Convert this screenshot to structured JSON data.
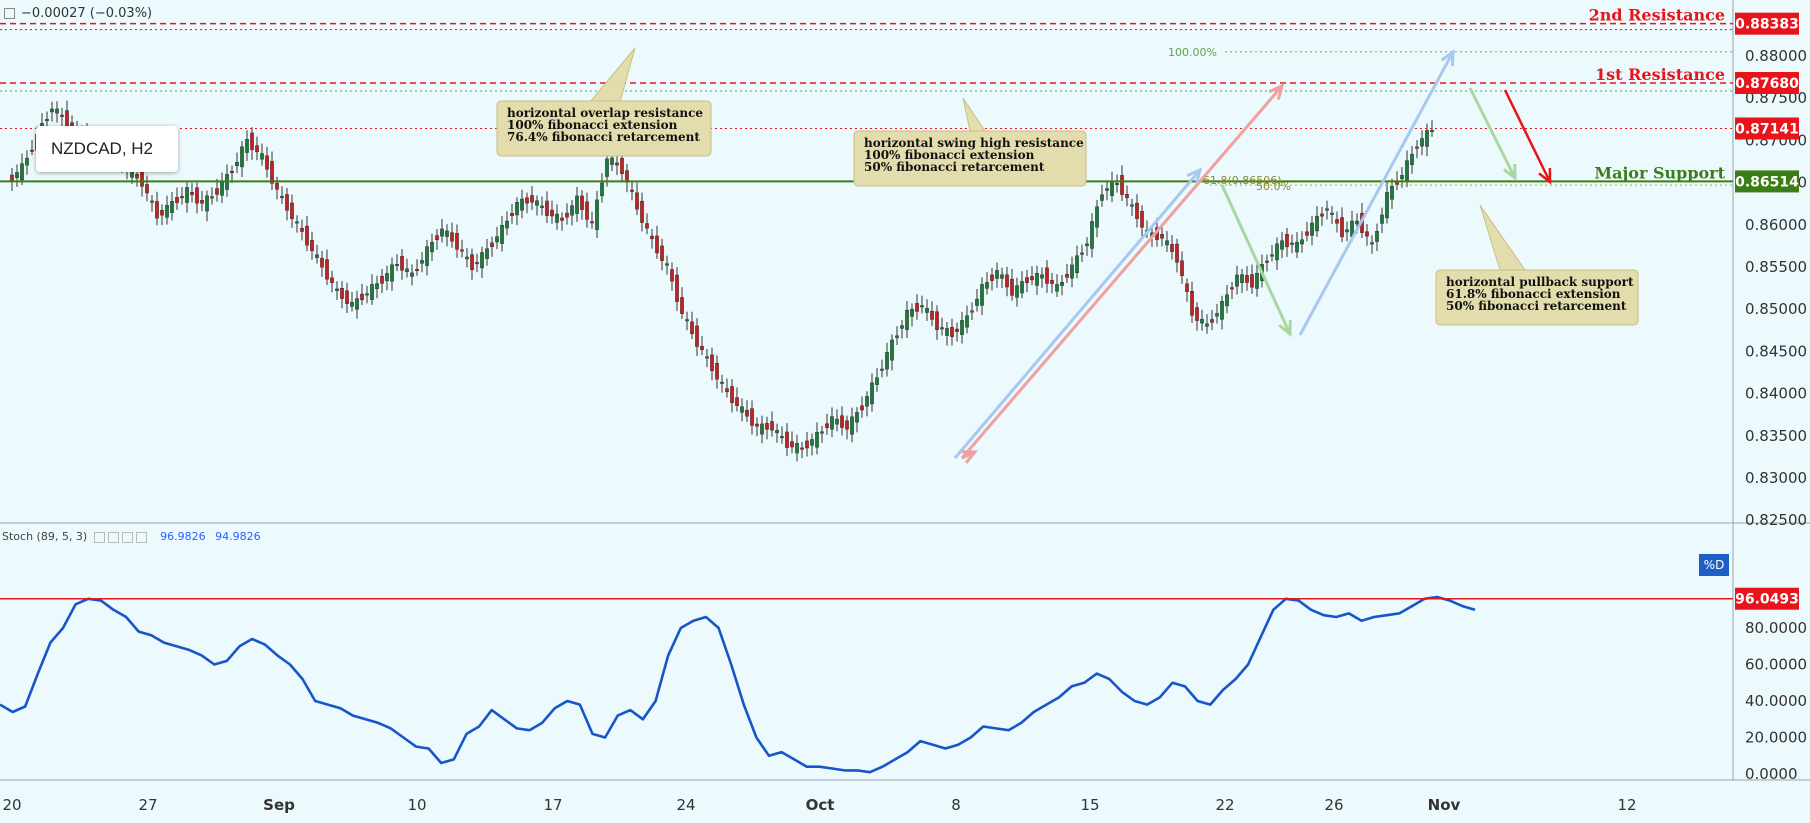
{
  "header": {
    "change_text": "−0.00027 (−0.03%)"
  },
  "symbol": {
    "label": "NZDCAD, H2"
  },
  "stoch_header": {
    "label": "Stoch (89, 5, 3)",
    "k_value": "96.9826",
    "d_value": "94.9826"
  },
  "pct_d_label": "%D",
  "colors": {
    "background": "#ecf9fd",
    "candle_up": "#1d7a3a",
    "candle_down": "#c22222",
    "resistance": "#e8141b",
    "support": "#3b7d16",
    "stoch_line": "#1656c9",
    "annotation_bg": "#e3dcac"
  },
  "chart_data": [
    {
      "type": "candlestick",
      "title": "NZDCAD, H2",
      "ylim": [
        0.8245,
        0.8857
      ],
      "y_ticks": [
        "0.88000",
        "0.87500",
        "0.87000",
        "0.86500",
        "0.86000",
        "0.85500",
        "0.85000",
        "0.84500",
        "0.84000",
        "0.83500",
        "0.83000",
        "0.82500"
      ],
      "x_ticks": [
        "20",
        "27",
        "Sep",
        "10",
        "17",
        "24",
        "Oct",
        "8",
        "15",
        "22",
        "26",
        "Nov",
        "12"
      ],
      "price_path": [
        [
          20,
          0.865
        ],
        [
          21,
          0.8668
        ],
        [
          22,
          0.8705
        ],
        [
          23,
          0.874
        ],
        [
          24,
          0.872
        ],
        [
          25,
          0.87
        ],
        [
          26,
          0.8675
        ],
        [
          27,
          0.869
        ],
        [
          28,
          0.8665
        ],
        [
          29,
          0.865
        ],
        [
          30,
          0.861
        ],
        [
          31,
          0.8625
        ],
        [
          32,
          0.864
        ],
        [
          33,
          0.8625
        ],
        [
          34,
          0.864
        ],
        [
          35,
          0.8665
        ],
        [
          36,
          0.87
        ],
        [
          37,
          0.868
        ],
        [
          38,
          0.864
        ],
        [
          39,
          0.861
        ],
        [
          40,
          0.858
        ],
        [
          41,
          0.855
        ],
        [
          42,
          0.852
        ],
        [
          43,
          0.8505
        ],
        [
          44,
          0.852
        ],
        [
          45,
          0.8535
        ],
        [
          46,
          0.8555
        ],
        [
          47,
          0.854
        ],
        [
          48,
          0.857
        ],
        [
          49,
          0.8595
        ],
        [
          50,
          0.8575
        ],
        [
          51,
          0.855
        ],
        [
          52,
          0.857
        ],
        [
          53,
          0.8595
        ],
        [
          54,
          0.8625
        ],
        [
          55,
          0.863
        ],
        [
          56,
          0.8615
        ],
        [
          57,
          0.8605
        ],
        [
          58,
          0.863
        ],
        [
          59,
          0.86
        ],
        [
          60,
          0.868
        ],
        [
          61,
          0.8665
        ],
        [
          62,
          0.862
        ],
        [
          63,
          0.858
        ],
        [
          64,
          0.855
        ],
        [
          65,
          0.8495
        ],
        [
          66,
          0.846
        ],
        [
          67,
          0.843
        ],
        [
          68,
          0.84
        ],
        [
          69,
          0.838
        ],
        [
          70,
          0.836
        ],
        [
          71,
          0.836
        ],
        [
          72,
          0.834
        ],
        [
          73,
          0.8335
        ],
        [
          74,
          0.835
        ],
        [
          75,
          0.837
        ],
        [
          76,
          0.836
        ],
        [
          77,
          0.8385
        ],
        [
          78,
          0.842
        ],
        [
          79,
          0.846
        ],
        [
          80,
          0.8495
        ],
        [
          81,
          0.8505
        ],
        [
          82,
          0.848
        ],
        [
          83,
          0.847
        ],
        [
          84,
          0.849
        ],
        [
          85,
          0.8525
        ],
        [
          86,
          0.8545
        ],
        [
          87,
          0.852
        ],
        [
          88,
          0.8535
        ],
        [
          89,
          0.854
        ],
        [
          90,
          0.8525
        ],
        [
          91,
          0.855
        ],
        [
          92,
          0.858
        ],
        [
          93,
          0.864
        ],
        [
          94,
          0.865
        ],
        [
          95,
          0.862
        ],
        [
          96,
          0.859
        ],
        [
          97,
          0.8585
        ],
        [
          98,
          0.856
        ],
        [
          99,
          0.8495
        ],
        [
          100,
          0.848
        ],
        [
          101,
          0.8505
        ],
        [
          102,
          0.854
        ],
        [
          103,
          0.853
        ],
        [
          104,
          0.856
        ],
        [
          105,
          0.858
        ],
        [
          106,
          0.8575
        ],
        [
          107,
          0.86
        ],
        [
          108,
          0.862
        ],
        [
          109,
          0.859
        ],
        [
          110,
          0.8605
        ],
        [
          111,
          0.8575
        ],
        [
          112,
          0.8635
        ],
        [
          113,
          0.866
        ],
        [
          114,
          0.8695
        ],
        [
          115,
          0.8714
        ]
      ],
      "levels": [
        {
          "name": "2nd Resistance",
          "value": 0.88383,
          "label": "0.88383",
          "style": "dashed",
          "color": "#e8141b"
        },
        {
          "name": "1st Resistance",
          "value": 0.8768,
          "label": "0.87680",
          "style": "dashed",
          "color": "#e8141b"
        },
        {
          "name": "",
          "value": 0.87141,
          "label": "0.87141",
          "style": "dotted",
          "color": "#e8141b"
        },
        {
          "name": "Major Support",
          "value": 0.86514,
          "label": "0.86514",
          "style": "solid",
          "color": "#3b7d16"
        }
      ],
      "fib_labels": [
        {
          "text": "100.00%",
          "value": 0.8805
        },
        {
          "text": "61.8(0.86506)",
          "value": 0.86506
        },
        {
          "text": "50.0%",
          "value": 0.8647
        }
      ],
      "annotations": [
        {
          "lines": [
            "horizontal overlap resistance",
            "100% fibonacci extension",
            "76.4% fibonacci retarcement"
          ]
        },
        {
          "lines": [
            "horizontal swing high resistance",
            "100% fibonacci extension",
            "50% fibonacci retarcement"
          ]
        },
        {
          "lines": [
            "horizontal pullback support",
            "61.8% fibonacci extension",
            "50% fibonacci retarcement"
          ]
        }
      ]
    },
    {
      "type": "line",
      "series": [
        {
          "name": "Stoch (89, 5, 3)",
          "values": [
            38,
            34,
            37,
            55,
            72,
            80,
            93,
            96,
            95,
            90,
            86,
            78,
            76,
            72,
            70,
            68,
            65,
            60,
            62,
            70,
            74,
            71,
            65,
            60,
            52,
            40,
            38,
            36,
            32,
            30,
            28,
            25,
            20,
            15,
            14,
            6,
            8,
            22,
            26,
            35,
            30,
            25,
            24,
            28,
            36,
            40,
            38,
            22,
            20,
            32,
            35,
            30,
            40,
            65,
            80,
            84,
            86,
            80,
            60,
            38,
            20,
            10,
            12,
            8,
            4,
            4,
            3,
            2,
            2,
            1,
            4,
            8,
            12,
            18,
            16,
            14,
            16,
            20,
            26,
            25,
            24,
            28,
            34,
            38,
            42,
            48,
            50,
            55,
            52,
            45,
            40,
            38,
            42,
            50,
            48,
            40,
            38,
            46,
            52,
            60,
            75,
            90,
            96,
            95,
            90,
            87,
            86,
            88,
            84,
            86,
            87,
            88,
            92,
            96,
            97,
            95,
            92,
            90
          ]
        }
      ],
      "ylim": [
        -1,
        102
      ],
      "y_ticks": [
        "80.0000",
        "60.0000",
        "40.0000",
        "20.0000",
        "0.0000"
      ],
      "current_value": "96.0493",
      "overbought_line": 96.0493
    }
  ]
}
